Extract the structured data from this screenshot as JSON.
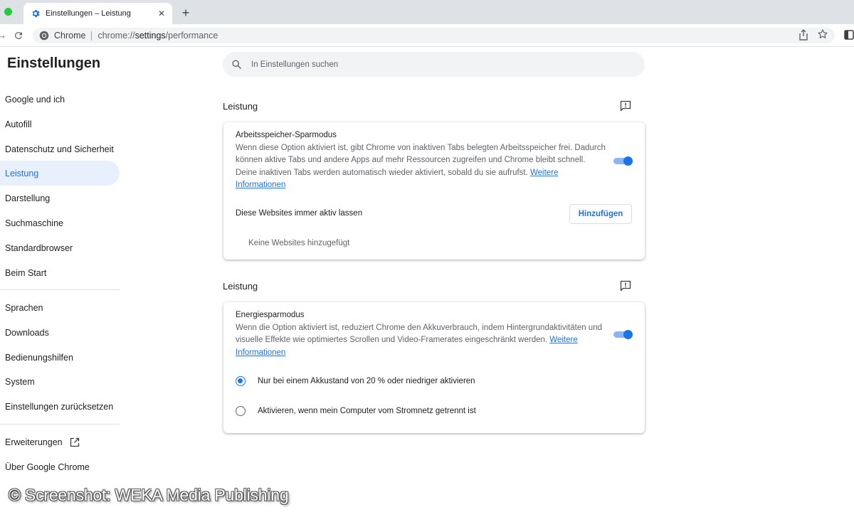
{
  "browser": {
    "tab_title": "Einstellungen – Leistung",
    "close_glyph": "✕",
    "new_tab_glyph": "+",
    "back_glyph": "→",
    "omnibox_chip": "Chrome",
    "url_scheme": "chrome://",
    "url_host": "settings",
    "url_path": "/performance"
  },
  "page_title": "Einstellungen",
  "search": {
    "placeholder": "In Einstellungen suchen"
  },
  "sidebar": {
    "items": [
      {
        "label": "Google und ich"
      },
      {
        "label": "Autofill"
      },
      {
        "label": "Datenschutz und Sicherheit"
      },
      {
        "label": "Leistung",
        "active": true
      },
      {
        "label": "Darstellung"
      },
      {
        "label": "Suchmaschine"
      },
      {
        "label": "Standardbrowser"
      },
      {
        "label": "Beim Start"
      },
      {
        "label": "Sprachen"
      },
      {
        "label": "Downloads"
      },
      {
        "label": "Bedienungshilfen"
      },
      {
        "label": "System"
      },
      {
        "label": "Einstellungen zurücksetzen"
      },
      {
        "label": "Erweiterungen"
      },
      {
        "label": "Über Google Chrome"
      }
    ]
  },
  "memory_section": {
    "heading": "Leistung",
    "title": "Arbeitsspeicher-Sparmodus",
    "description": "Wenn diese Option aktiviert ist, gibt Chrome von inaktiven Tabs belegten Arbeitsspeicher frei. Dadurch können aktive Tabs und andere Apps auf mehr Ressourcen zugreifen und Chrome bleibt schnell. Deine inaktiven Tabs werden automatisch wieder aktiviert, sobald du sie aufrufst.",
    "link": "Weitere Informationen",
    "enabled": true,
    "always_active_label": "Diese Websites immer aktiv lassen",
    "add_button": "Hinzufügen",
    "empty_label": "Keine Websites hinzugefügt"
  },
  "energy_section": {
    "heading": "Leistung",
    "title": "Energiesparmodus",
    "description": "Wenn die Option aktiviert ist, reduziert Chrome den Akkuverbrauch, indem Hintergrundaktivitäten und visuelle Effekte wie optimiertes Scrollen und Video-Framerates eingeschränkt werden.",
    "link": "Weitere Informationen",
    "enabled": true,
    "options": [
      {
        "label": "Nur bei einem Akkustand von 20 % oder niedriger aktivieren",
        "checked": true
      },
      {
        "label": "Aktivieren, wenn mein Computer vom Stromnetz getrennt ist",
        "checked": false
      }
    ]
  },
  "watermark": "© Screenshot: WEKA Media Publishing",
  "colors": {
    "accent": "#1a73e8",
    "active_bg": "#e8f0fe",
    "toggle_track": "#8ab4f8",
    "traffic_green": "#28c840"
  },
  "icons": [
    "settings-gear-icon",
    "close-icon",
    "plus-icon",
    "reload-icon",
    "chrome-logo-icon",
    "share-icon",
    "star-icon",
    "side-panel-icon",
    "search-icon",
    "feedback-icon",
    "external-link-icon"
  ]
}
